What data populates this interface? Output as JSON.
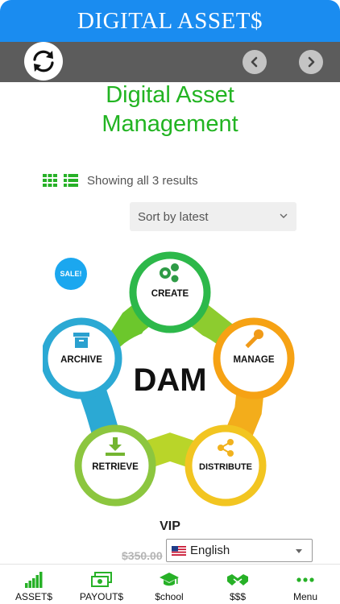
{
  "header": {
    "title": "DIGITAL ASSET$"
  },
  "toolbar": {
    "refresh_icon": "refresh-icon",
    "prev_icon": "chevron-left-icon",
    "next_icon": "chevron-right-icon"
  },
  "page": {
    "title_line1": "Digital Asset",
    "title_line2": "Management"
  },
  "results": {
    "text": "Showing all 3 results"
  },
  "sort": {
    "selected": "Sort by latest"
  },
  "product": {
    "sale_badge": "SALE!",
    "image_center": "DAM",
    "image_nodes": [
      "CREATE",
      "MANAGE",
      "DISTRIBUTE",
      "RETRIEVE",
      "ARCHIVE"
    ],
    "name": "VIP",
    "old_price": "$350.00"
  },
  "language": {
    "selected": "English"
  },
  "tabbar": {
    "items": [
      {
        "label": "ASSET$",
        "icon": "bar-chart-icon"
      },
      {
        "label": "PAYOUT$",
        "icon": "money-icon"
      },
      {
        "label": "$chool",
        "icon": "graduation-cap-icon"
      },
      {
        "label": "$$$",
        "icon": "handshake-icon"
      },
      {
        "label": "Menu",
        "icon": "more-dots-icon"
      }
    ]
  },
  "colors": {
    "header_blue": "#1a8cf0",
    "toolbar_gray": "#5c5c5c",
    "accent_green": "#22b422",
    "sale_blue": "#1ba7ef",
    "tab_icon_green": "#27b127"
  }
}
